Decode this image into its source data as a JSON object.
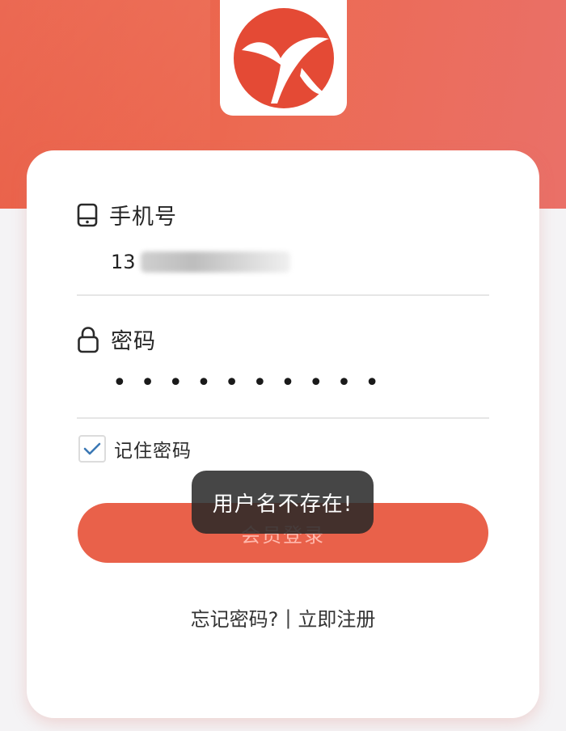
{
  "login_form": {
    "phone_label": "手机号",
    "phone_value": "13",
    "password_label": "密码",
    "password_mask": "••••••••••",
    "remember_label": "记住密码",
    "remember_checked": true,
    "login_button_label": "会员登录",
    "forgot_link": "忘记密码?",
    "separator": "|",
    "register_link": "立即注册"
  },
  "toast": {
    "message": "用户名不存在!"
  },
  "icons": {
    "logo": "brand-logo",
    "phone": "phone-icon",
    "lock": "lock-icon",
    "check": "check-icon"
  },
  "colors": {
    "brand": "#e9583f",
    "button": "#e9614a"
  }
}
